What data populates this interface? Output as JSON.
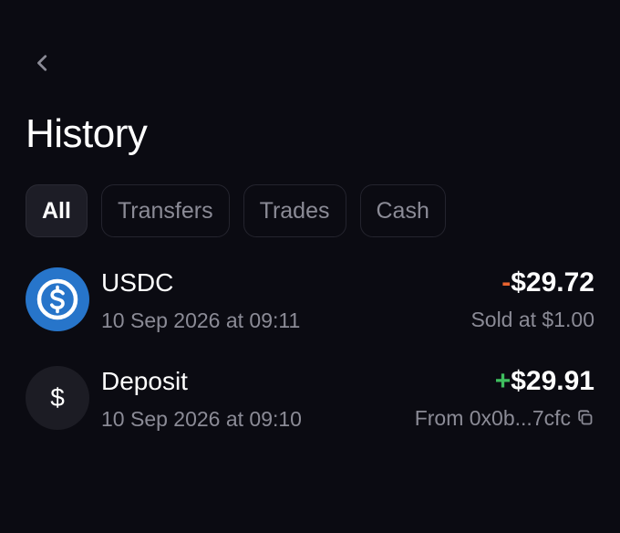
{
  "header": {
    "back_icon": "chevron-left-icon",
    "title": "History"
  },
  "tabs": [
    {
      "label": "All",
      "active": true
    },
    {
      "label": "Transfers",
      "active": false
    },
    {
      "label": "Trades",
      "active": false
    },
    {
      "label": "Cash",
      "active": false
    }
  ],
  "transactions": [
    {
      "icon": "usdc-coin-icon",
      "name": "USDC",
      "date": "10 Sep 2026 at 09:11",
      "sign": "-",
      "amount": "$29.72",
      "detail": "Sold at $1.00"
    },
    {
      "icon": "dollar-icon",
      "name": "Deposit",
      "date": "10 Sep 2026 at 09:10",
      "sign": "+",
      "amount": "$29.91",
      "detail": "From 0x0b...7cfc",
      "detail_icon": "copy-icon"
    }
  ],
  "colors": {
    "background": "#0b0b12",
    "negative": "#e8632f",
    "positive": "#3fbf5f",
    "usdc_blue": "#2775ca",
    "muted_text": "#8b8b96"
  }
}
